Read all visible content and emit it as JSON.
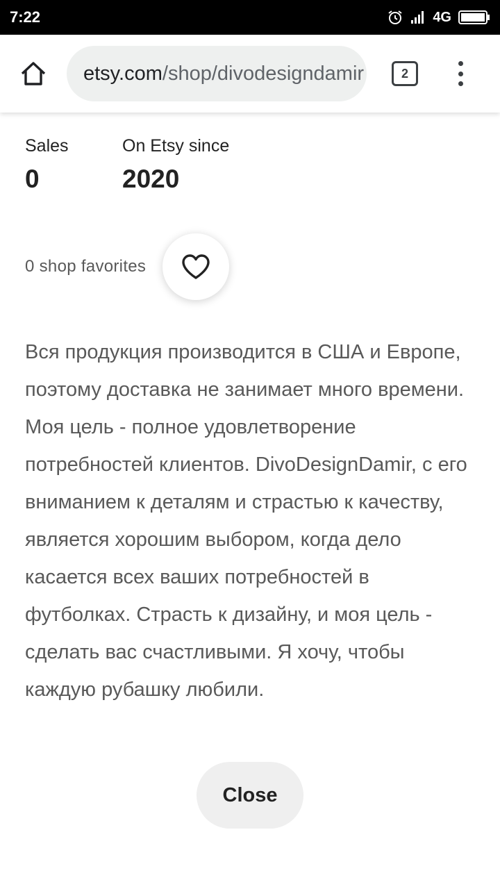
{
  "status_bar": {
    "time": "7:22",
    "network": "4G",
    "icons": [
      "alarm-icon",
      "signal-icon",
      "battery-icon"
    ]
  },
  "browser": {
    "url_domain": "etsy.com",
    "url_path": "/shop/divodesigndamir",
    "tab_count": "2",
    "icons": [
      "home-icon",
      "more-vert-icon"
    ]
  },
  "shop_stats": {
    "sales_label": "Sales",
    "sales_value": "0",
    "since_label": "On Etsy since",
    "since_value": "2020"
  },
  "favorites": {
    "text": "0 shop favorites",
    "icon": "heart-icon"
  },
  "description": "Вся продукция производится в США и Европе, поэтому доставка не занимает много времени. Моя цель - полное удовлетворение потребностей клиентов. DivoDesignDamir, с его вниманием к деталям и страстью к качеству, является хорошим выбором, когда дело касается всех ваших потребностей в футболках. Страсть к дизайну, и моя цель - сделать вас счастливыми. Я хочу, чтобы каждую рубашку любили.",
  "close_label": "Close",
  "colors": {
    "status_bar_bg": "#000000",
    "url_bar_bg": "#eef0ef",
    "text_primary": "#222222",
    "text_secondary": "#595959",
    "close_button_bg": "#efefef"
  }
}
